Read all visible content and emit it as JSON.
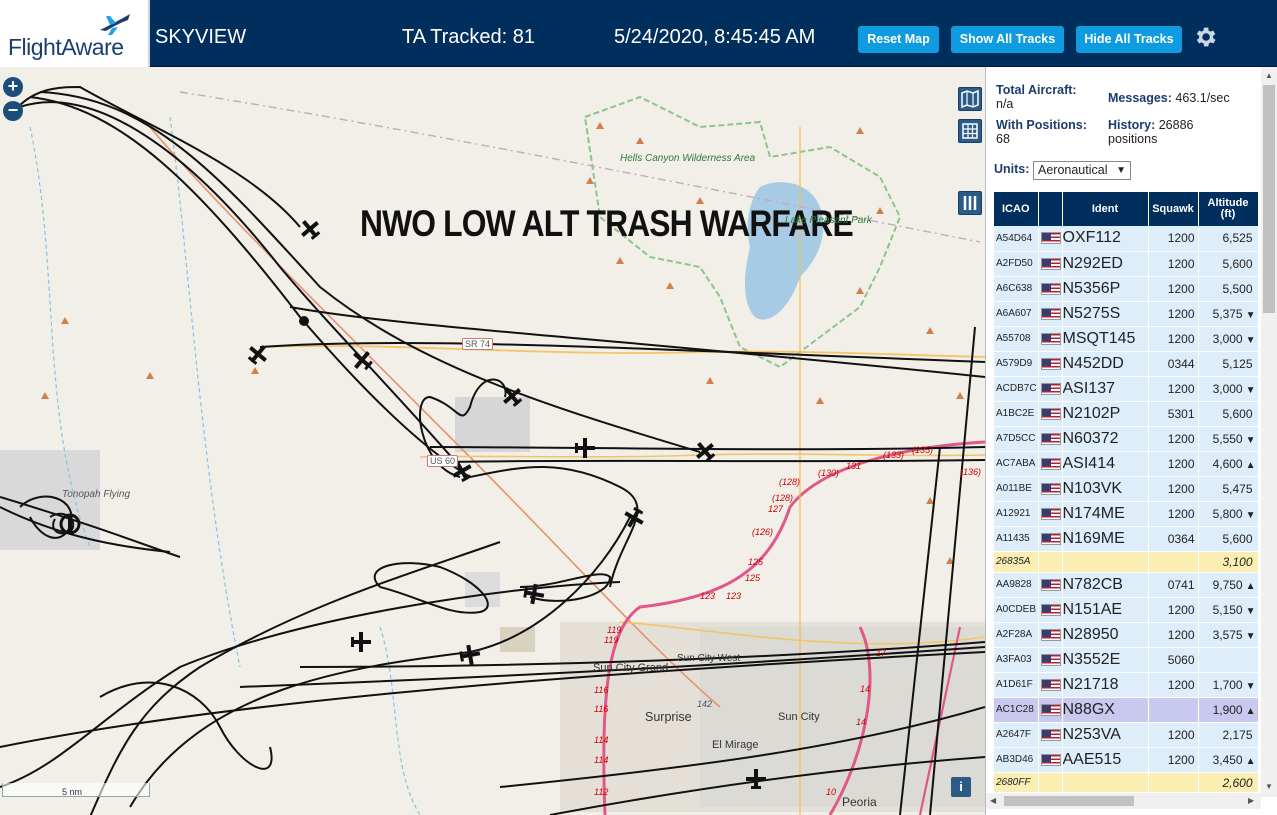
{
  "header": {
    "logo": "FlightAware",
    "app_name": "SKYVIEW",
    "tracked": "TA Tracked: 81",
    "datetime": "5/24/2020, 8:45:45 AM",
    "buttons": {
      "reset": "Reset Map",
      "show": "Show All Tracks",
      "hide": "Hide All Tracks"
    },
    "accent_color": "#0e9be0",
    "bar_color": "#002f5d"
  },
  "map": {
    "overlay_title": "NWO LOW ALT TRASH WARFARE",
    "zoom_in": "+",
    "zoom_out": "−",
    "scale": "5 nm",
    "info": "i",
    "labels": {
      "hells_canyon": "Hells Canyon Wilderness Area",
      "lake_pleasant": "Lake Pleasant Park",
      "tonopah": "Tonopah Flying",
      "sun_city_grand": "Sun City Grand",
      "sun_city_west": "Sun City West",
      "surprise": "Surprise",
      "sun_city": "Sun City",
      "el_mirage": "El Mirage",
      "peoria": "Peoria",
      "sr74": "SR 74",
      "us60": "US 60"
    },
    "routes": [
      "(135)",
      "(133)",
      "(136)",
      "(130)",
      "131",
      "(128)",
      "(128)",
      "127",
      "(126)",
      "125",
      "125",
      "123",
      "123",
      "119",
      "119",
      "116",
      "116",
      "114",
      "114",
      "112",
      "142",
      "17",
      "14",
      "14",
      "10"
    ]
  },
  "sidebar": {
    "total_aircraft_label": "Total Aircraft:",
    "total_aircraft_value": "n/a",
    "messages_label": "Messages:",
    "messages_value": "463.1/sec",
    "with_positions_label": "With Positions:",
    "with_positions_value": "68",
    "history_label": "History:",
    "history_value": "26886",
    "history_unit": "positions",
    "units_label": "Units:",
    "units_value": "Aeronautical",
    "columns": {
      "icao": "ICAO",
      "ident": "Ident",
      "squawk": "Squawk",
      "altitude": "Altitude",
      "altitude_unit": "(ft)"
    },
    "rows": [
      {
        "icao": "A54D64",
        "flag": true,
        "ident": "OXF112",
        "squawk": "1200",
        "alt": "6,525",
        "trend": ""
      },
      {
        "icao": "A2FD50",
        "flag": true,
        "ident": "N292ED",
        "squawk": "1200",
        "alt": "5,600",
        "trend": ""
      },
      {
        "icao": "A6C638",
        "flag": true,
        "ident": "N5356P",
        "squawk": "1200",
        "alt": "5,500",
        "trend": ""
      },
      {
        "icao": "A6A607",
        "flag": true,
        "ident": "N5275S",
        "squawk": "1200",
        "alt": "5,375",
        "trend": "▼"
      },
      {
        "icao": "A55708",
        "flag": true,
        "ident": "MSQT145",
        "squawk": "1200",
        "alt": "3,000",
        "trend": "▼"
      },
      {
        "icao": "A579D9",
        "flag": true,
        "ident": "N452DD",
        "squawk": "0344",
        "alt": "5,125",
        "trend": ""
      },
      {
        "icao": "ACDB7C",
        "flag": true,
        "ident": "ASI137",
        "squawk": "1200",
        "alt": "3,000",
        "trend": "▼"
      },
      {
        "icao": "A1BC2E",
        "flag": true,
        "ident": "N2102P",
        "squawk": "5301",
        "alt": "5,600",
        "trend": ""
      },
      {
        "icao": "A7D5CC",
        "flag": true,
        "ident": "N60372",
        "squawk": "1200",
        "alt": "5,550",
        "trend": "▼"
      },
      {
        "icao": "AC7ABA",
        "flag": true,
        "ident": "ASI414",
        "squawk": "1200",
        "alt": "4,600",
        "trend": "▲"
      },
      {
        "icao": "A011BE",
        "flag": true,
        "ident": "N103VK",
        "squawk": "1200",
        "alt": "5,475",
        "trend": ""
      },
      {
        "icao": "A12921",
        "flag": true,
        "ident": "N174ME",
        "squawk": "1200",
        "alt": "5,800",
        "trend": "▼"
      },
      {
        "icao": "A11435",
        "flag": true,
        "ident": "N169ME",
        "squawk": "0364",
        "alt": "5,600",
        "trend": ""
      },
      {
        "icao": "26835A",
        "flag": false,
        "ident": "",
        "squawk": "",
        "alt": "3,100",
        "trend": "",
        "nodata": true
      },
      {
        "icao": "AA9828",
        "flag": true,
        "ident": "N782CB",
        "squawk": "0741",
        "alt": "9,750",
        "trend": "▲"
      },
      {
        "icao": "A0CDEB",
        "flag": true,
        "ident": "N151AE",
        "squawk": "1200",
        "alt": "5,150",
        "trend": "▼"
      },
      {
        "icao": "A2F28A",
        "flag": true,
        "ident": "N28950",
        "squawk": "1200",
        "alt": "3,575",
        "trend": "▼"
      },
      {
        "icao": "A3FA03",
        "flag": true,
        "ident": "N3552E",
        "squawk": "5060",
        "alt": "",
        "trend": ""
      },
      {
        "icao": "A1D61F",
        "flag": true,
        "ident": "N21718",
        "squawk": "1200",
        "alt": "1,700",
        "trend": "▼"
      },
      {
        "icao": "AC1C28",
        "flag": true,
        "ident": "N88GX",
        "squawk": "",
        "alt": "1,900",
        "trend": "▲",
        "selected": true
      },
      {
        "icao": "A2647F",
        "flag": true,
        "ident": "N253VA",
        "squawk": "1200",
        "alt": "2,175",
        "trend": ""
      },
      {
        "icao": "AB3D46",
        "flag": true,
        "ident": "AAE515",
        "squawk": "1200",
        "alt": "3,450",
        "trend": "▲"
      },
      {
        "icao": "2680FF",
        "flag": false,
        "ident": "",
        "squawk": "",
        "alt": "2,600",
        "trend": "",
        "nodata": true
      }
    ]
  }
}
